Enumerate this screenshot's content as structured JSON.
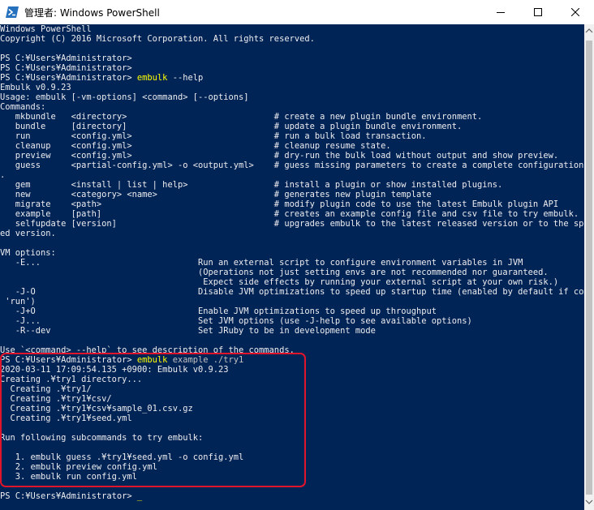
{
  "window": {
    "title": "管理者: Windows PowerShell",
    "icon": "powershell-icon",
    "controls": [
      "minimize-icon",
      "maximize-icon",
      "close-icon"
    ]
  },
  "console": {
    "colors": {
      "background": "#012456",
      "text": "#eeedf0",
      "command": "#ffff00",
      "parameter": "#c0c0c0",
      "highlight_border": "#e0142a"
    },
    "lines": [
      {
        "segments": [
          {
            "text": "Windows PowerShell"
          }
        ]
      },
      {
        "segments": [
          {
            "text": "Copyright (C) 2016 Microsoft Corporation. All rights reserved."
          }
        ]
      },
      {
        "segments": [
          {
            "text": ""
          }
        ]
      },
      {
        "segments": [
          {
            "text": "PS C:¥Users¥Administrator>"
          }
        ]
      },
      {
        "segments": [
          {
            "text": "PS C:¥Users¥Administrator>"
          }
        ]
      },
      {
        "segments": [
          {
            "text": "PS C:¥Users¥Administrator> "
          },
          {
            "text": "embulk",
            "style": "yellow"
          },
          {
            "text": " --help"
          }
        ]
      },
      {
        "segments": [
          {
            "text": "Embulk v0.9.23"
          }
        ]
      },
      {
        "segments": [
          {
            "text": "Usage: embulk [-vm-options] <command> [--options]"
          }
        ]
      },
      {
        "segments": [
          {
            "text": "Commands:"
          }
        ]
      },
      {
        "segments": [
          {
            "text": "   mkbundle   <directory>                             # create a new plugin bundle environment."
          }
        ]
      },
      {
        "segments": [
          {
            "text": "   bundle     [directory]                             # update a plugin bundle environment."
          }
        ]
      },
      {
        "segments": [
          {
            "text": "   run        <config.yml>                            # run a bulk load transaction."
          }
        ]
      },
      {
        "segments": [
          {
            "text": "   cleanup    <config.yml>                            # cleanup resume state."
          }
        ]
      },
      {
        "segments": [
          {
            "text": "   preview    <config.yml>                            # dry-run the bulk load without output and show preview."
          }
        ]
      },
      {
        "segments": [
          {
            "text": "   guess      <partial-config.yml> -o <output.yml>    # guess missing parameters to create a complete configuration file"
          }
        ]
      },
      {
        "segments": [
          {
            "text": "."
          }
        ]
      },
      {
        "segments": [
          {
            "text": "   gem        <install | list | help>                 # install a plugin or show installed plugins."
          }
        ]
      },
      {
        "segments": [
          {
            "text": "   new        <category> <name>                       # generates new plugin template"
          }
        ]
      },
      {
        "segments": [
          {
            "text": "   migrate    <path>                                  # modify plugin code to use the latest Embulk plugin API"
          }
        ]
      },
      {
        "segments": [
          {
            "text": "   example    [path]                                  # creates an example config file and csv file to try embulk."
          }
        ]
      },
      {
        "segments": [
          {
            "text": "   selfupdate [version]                               # upgrades embulk to the latest released version or to the specifi"
          }
        ]
      },
      {
        "segments": [
          {
            "text": "ed version."
          }
        ]
      },
      {
        "segments": [
          {
            "text": ""
          }
        ]
      },
      {
        "segments": [
          {
            "text": "VM options:"
          }
        ]
      },
      {
        "segments": [
          {
            "text": "   -E...                               Run an external script to configure environment variables in JVM"
          }
        ]
      },
      {
        "segments": [
          {
            "text": "                                       (Operations not just setting envs are not recommended nor guaranteed."
          }
        ]
      },
      {
        "segments": [
          {
            "text": "                                        Expect side effects by running your external script at your own risk.)"
          }
        ]
      },
      {
        "segments": [
          {
            "text": "   -J-O                                Disable JVM optimizations to speed up startup time (enabled by default if command is"
          }
        ]
      },
      {
        "segments": [
          {
            "text": " 'run')"
          }
        ]
      },
      {
        "segments": [
          {
            "text": "   -J+O                                Enable JVM optimizations to speed up throughput"
          }
        ]
      },
      {
        "segments": [
          {
            "text": "   -J...                               Set JVM options (use -J-help to see available options)"
          }
        ]
      },
      {
        "segments": [
          {
            "text": "   -R--dev                             Set JRuby to be in development mode"
          }
        ]
      },
      {
        "segments": [
          {
            "text": ""
          }
        ]
      },
      {
        "segments": [
          {
            "text": "Use `<command> --help` to see description of the commands."
          }
        ]
      },
      {
        "segments": [
          {
            "text": "PS C:¥Users¥Administrator> "
          },
          {
            "text": "embulk",
            "style": "yellow"
          },
          {
            "text": " example ",
            "style": "gray"
          },
          {
            "text": "./try1",
            "style": "gray"
          }
        ]
      },
      {
        "segments": [
          {
            "text": "2020-03-11 17:09:54.135 +0900: Embulk v0.9.23"
          }
        ]
      },
      {
        "segments": [
          {
            "text": "Creating .¥try1 directory..."
          }
        ]
      },
      {
        "segments": [
          {
            "text": "  Creating .¥try1/"
          }
        ]
      },
      {
        "segments": [
          {
            "text": "  Creating .¥try1¥csv/"
          }
        ]
      },
      {
        "segments": [
          {
            "text": "  Creating .¥try1¥csv¥sample_01.csv.gz"
          }
        ]
      },
      {
        "segments": [
          {
            "text": "  Creating .¥try1¥seed.yml"
          }
        ]
      },
      {
        "segments": [
          {
            "text": ""
          }
        ]
      },
      {
        "segments": [
          {
            "text": "Run following subcommands to try embulk:"
          }
        ]
      },
      {
        "segments": [
          {
            "text": ""
          }
        ]
      },
      {
        "segments": [
          {
            "text": "   1. embulk guess .¥try1¥seed.yml -o config.yml"
          }
        ]
      },
      {
        "segments": [
          {
            "text": "   2. embulk preview config.yml"
          }
        ]
      },
      {
        "segments": [
          {
            "text": "   3. embulk run config.yml"
          }
        ]
      },
      {
        "segments": [
          {
            "text": ""
          }
        ]
      },
      {
        "segments": [
          {
            "text": "PS C:¥Users¥Administrator> "
          },
          {
            "text": "_",
            "style": "cursor"
          }
        ]
      }
    ]
  },
  "scrollbar": {
    "icons": [
      "scroll-up-arrow-icon",
      "scroll-down-arrow-icon"
    ]
  }
}
